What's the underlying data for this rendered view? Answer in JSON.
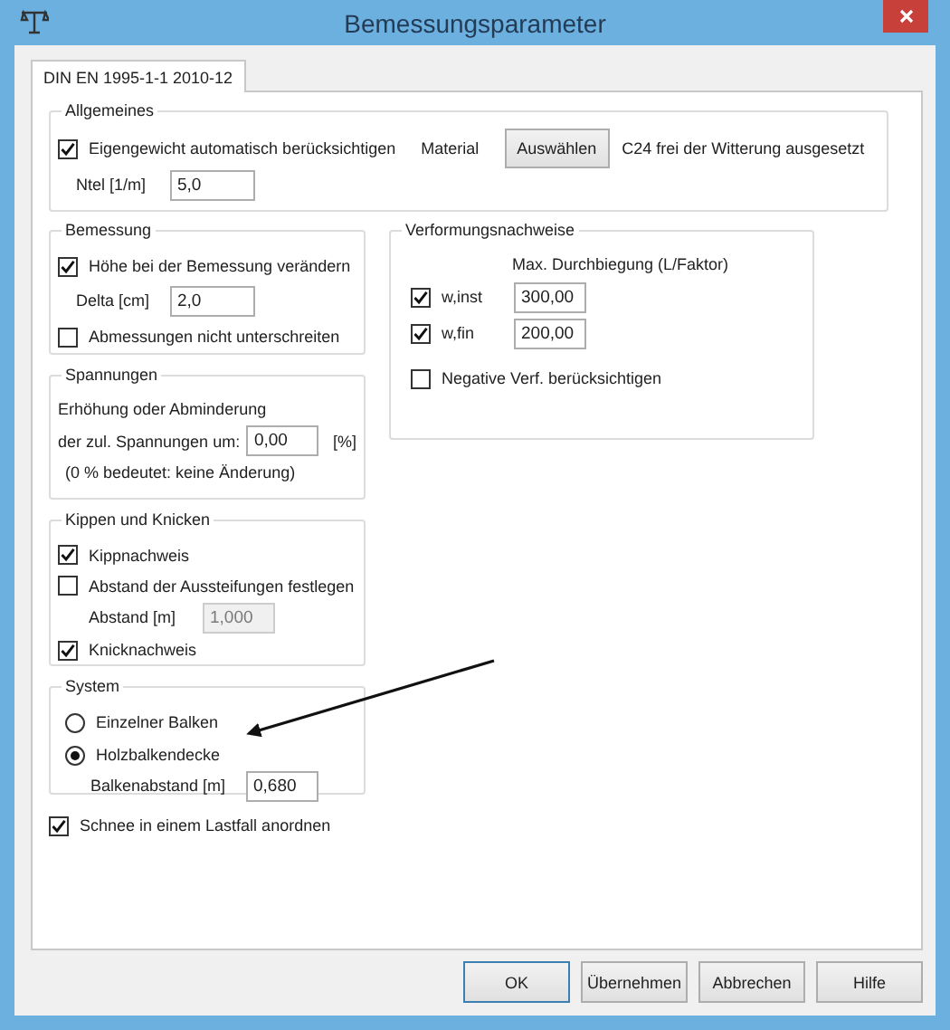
{
  "window": {
    "title": "Bemessungsparameter"
  },
  "tabs": [
    {
      "label": "DIN EN 1995-1-1 2010-12",
      "selected": true
    }
  ],
  "allgemeines": {
    "title": "Allgemeines",
    "eigengewicht": {
      "label": "Eigengewicht automatisch berücksichtigen",
      "checked": true
    },
    "material_label": "Material",
    "material_button": "Auswählen",
    "material_value": "C24 frei der Witterung ausgesetzt",
    "ntel": {
      "label": "Ntel [1/m]",
      "value": "5,0"
    }
  },
  "bemessung": {
    "title": "Bemessung",
    "hoehe": {
      "label": "Höhe bei der Bemessung verändern",
      "checked": true
    },
    "delta": {
      "label": "Delta [cm]",
      "value": "2,0"
    },
    "abmessungen": {
      "label": "Abmessungen nicht unterschreiten",
      "checked": false
    }
  },
  "spannungen": {
    "title": "Spannungen",
    "line1": "Erhöhung oder Abminderung",
    "line2": "der zul. Spannungen um:",
    "value": "0,00",
    "unit": "[%]",
    "note": "(0 % bedeutet: keine Änderung)"
  },
  "verformung": {
    "title": "Verformungsnachweise",
    "header": "Max. Durchbiegung (L/Faktor)",
    "rows": [
      {
        "label": "w,inst",
        "checked": true,
        "value": "300,00"
      },
      {
        "label": "w,fin",
        "checked": true,
        "value": "200,00"
      }
    ],
    "negative": {
      "label": "Negative Verf. berücksichtigen",
      "checked": false
    }
  },
  "kippen": {
    "title": "Kippen und Knicken",
    "kipp": {
      "label": "Kippnachweis",
      "checked": true
    },
    "abstand_fest": {
      "label": "Abstand der Aussteifungen festlegen",
      "checked": false
    },
    "abstand": {
      "label": "Abstand [m]",
      "value": "1,000",
      "disabled": true
    },
    "knick": {
      "label": "Knicknachweis",
      "checked": true
    }
  },
  "system": {
    "title": "System",
    "options": [
      {
        "label": "Einzelner Balken",
        "selected": false
      },
      {
        "label": "Holzbalkendecke",
        "selected": true
      }
    ],
    "balkenabstand": {
      "label": "Balkenabstand [m]",
      "value": "0,680"
    }
  },
  "schnee": {
    "label": "Schnee in einem Lastfall anordnen",
    "checked": true
  },
  "buttons": [
    "OK",
    "Übernehmen",
    "Abbrechen",
    "Hilfe"
  ]
}
